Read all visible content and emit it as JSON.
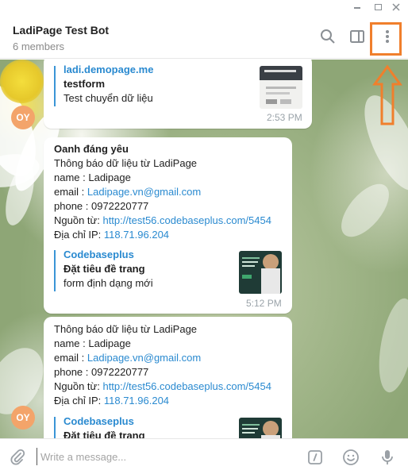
{
  "header": {
    "title": "LadiPage Test Bot",
    "subtitle": "6 members"
  },
  "messages": [
    {
      "preview": {
        "site": "ladi.demopage.me",
        "title": "testform",
        "desc": "Test chuyển dữ liệu"
      },
      "time": "2:53 PM"
    },
    {
      "sender": "Oanh đáng yêu",
      "lines": {
        "l1": "Thông báo dữ liệu từ LadiPage",
        "l2": "name : Ladipage",
        "l3_prefix": "email : ",
        "l3_link": "Ladipage.vn@gmail.com",
        "l4": "phone : 0972220777",
        "l5_prefix": "Nguồn từ: ",
        "l5_link": "http://test56.codebaseplus.com/5454",
        "l6_prefix": "Địa chỉ IP: ",
        "l6_link": "118.71.96.204"
      },
      "preview": {
        "site": "Codebaseplus",
        "title": "Đặt tiêu đề trang",
        "desc": "form định dạng mới"
      },
      "time": "5:12 PM"
    },
    {
      "lines": {
        "l1": "Thông báo dữ liệu từ LadiPage",
        "l2": "name : Ladipage",
        "l3_prefix": "email : ",
        "l3_link": "Ladipage.vn@gmail.com",
        "l4": "phone : 0972220777",
        "l5_prefix": "Nguồn từ: ",
        "l5_link": "http://test56.codebaseplus.com/5454",
        "l6_prefix": "Địa chỉ IP: ",
        "l6_link": "118.71.96.204"
      },
      "preview": {
        "site": "Codebaseplus",
        "title": "Đặt tiêu đề trang"
      }
    }
  ],
  "avatars": {
    "initials": "OY"
  },
  "compose": {
    "placeholder": "Write a message..."
  },
  "colors": {
    "accent": "#2a8ad0",
    "sender": "#e07b37",
    "highlight": "#f07f2c",
    "avatar": "#f3a46a"
  },
  "icons": [
    "minimize-icon",
    "maximize-icon",
    "close-icon",
    "search-icon",
    "side-panel-icon",
    "more-vertical-icon",
    "attach-icon",
    "commands-icon",
    "emoji-icon",
    "microphone-icon",
    "arrow-up-annotation"
  ]
}
